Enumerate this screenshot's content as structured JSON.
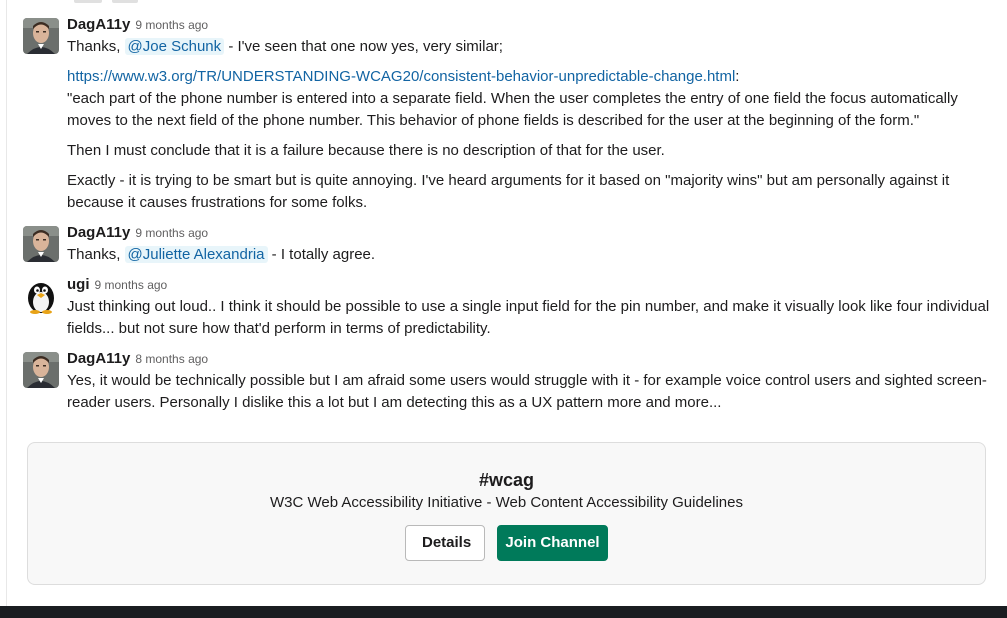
{
  "colors": {
    "link": "#1264a3",
    "mention_bg": "#e8f5fa",
    "join_button": "#007a5a",
    "bottom_bar": "#1a1d21"
  },
  "messages": [
    {
      "author": "DagA11y",
      "timestamp": "9 months ago",
      "avatar": "person-avatar",
      "line1_prefix": "Thanks, ",
      "line1_mention": "@Joe Schunk",
      "line1_suffix": " - I've seen that one now yes, very similar;",
      "link": "https://www.w3.org/TR/UNDERSTANDING-WCAG20/consistent-behavior-unpredictable-change.html",
      "link_suffix": ":",
      "quote": "\"each part of the phone number is entered into a separate field. When the user completes the entry of one field the focus automatically moves to the next field of the phone number. This behavior of phone fields is described for the user at the beginning of the form.\"",
      "para2": "Then I must conclude that it is a failure because there is no description of that for the user.",
      "para3": "Exactly - it is trying to be smart but is quite annoying. I've heard arguments for it based on \"majority wins\" but am personally against it because it causes frustrations for some folks."
    },
    {
      "author": "DagA11y",
      "timestamp": "9 months ago",
      "avatar": "person-avatar",
      "prefix": "Thanks, ",
      "mention": "@Juliette Alexandria",
      "suffix": " - I totally agree."
    },
    {
      "author": "ugi",
      "timestamp": "9 months ago",
      "avatar": "penguin-avatar",
      "text": "Just thinking out loud.. I think it should be possible to use a single input field for the pin number, and make it visually look like four individual fields... but not sure how that'd perform in terms of predictability."
    },
    {
      "author": "DagA11y",
      "timestamp": "8 months ago",
      "avatar": "person-avatar",
      "text": "Yes, it would be technically possible but I am afraid some users would struggle with it - for example voice control users and sighted screen-reader users. Personally I dislike this a lot but I am detecting this as a UX pattern more and more..."
    }
  ],
  "channel": {
    "name": "#wcag",
    "description": "W3C Web Accessibility Initiative - Web Content Accessibility Guidelines",
    "details_label": "Details",
    "join_label": "Join Channel"
  }
}
